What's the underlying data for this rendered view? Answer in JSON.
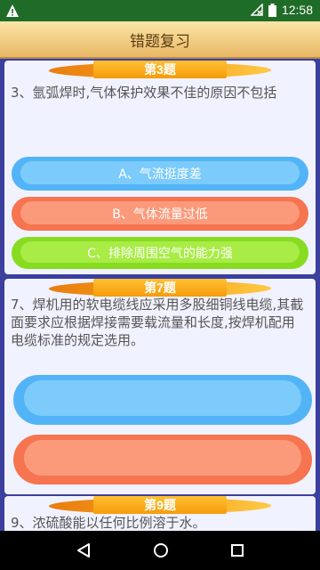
{
  "status_bar": {
    "time": "12:58",
    "icons": [
      "warning-icon",
      "signal-off-icon",
      "battery-icon"
    ]
  },
  "header": {
    "title": "错题复习"
  },
  "questions": [
    {
      "badge": "第3题",
      "text": "3、氩弧焊时,气体保护效果不佳的原因不包括",
      "options": [
        "A、气流挺度差",
        "B、气体流量过低",
        "C、排除周围空气的能力强"
      ]
    },
    {
      "badge": "第7题",
      "text": "7、焊机用的软电缆线应采用多股细铜线电缆,其截面要求应根据焊接需要载流量和长度,按焊机配用电缆标准的规定选用。",
      "options": [
        "✔",
        "✘"
      ]
    },
    {
      "badge": "第9题",
      "text": "9、浓硫酸能以任何比例溶于水。",
      "options": []
    }
  ],
  "navigation": {
    "buttons": [
      "back-icon",
      "home-icon",
      "recents-icon"
    ]
  },
  "colors": {
    "status_bar": "#1f6b28",
    "page_bg": "#3b3f9e",
    "card_bg": "#f1f2ff",
    "option_blue": "#52b4f6",
    "option_red": "#f6744f",
    "option_green": "#87dc21",
    "badge": "#f59c0b"
  }
}
